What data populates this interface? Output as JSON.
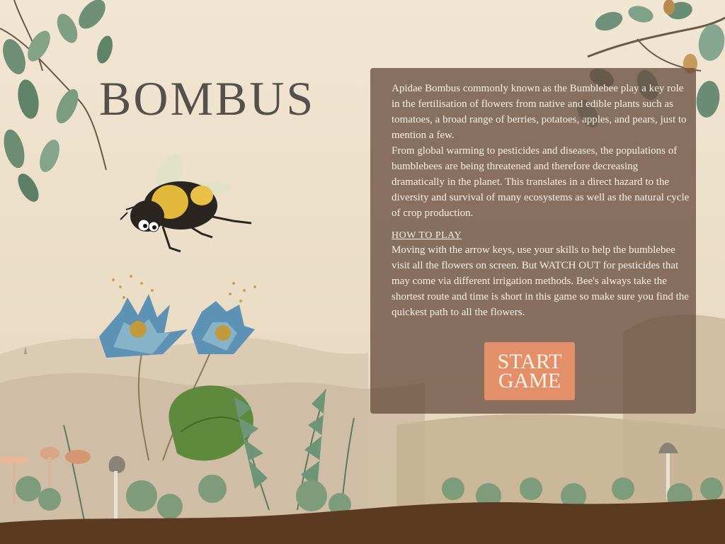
{
  "title": "BOMBUS",
  "intro": {
    "paragraphs": [
      "Apidae Bombus commonly known as the Bumblebee play a key role in the fertilisation of flowers from native and edible plants such as tomatoes, a broad range of berries, potatoes, apples, and pears, just to mention a few.",
      "From global warming to pesticides and diseases, the populations of bumblebees are being threatened and therefore decreasing dramatically in the planet. This translates in a direct hazard to the diversity and survival of many ecosystems as well as the natural cycle of crop production."
    ]
  },
  "how_to_play": {
    "heading": "HOW TO PLAY",
    "text": "Moving with the arrow keys, use your skills to help the bumblebee visit all the flowers on screen. But WATCH OUT for pesticides that may come via different irrigation methods. Bee's always take the shortest route and time is short in this game so make sure you find the quickest path to all the flowers."
  },
  "start_button": {
    "line1": "START",
    "line2": "GAME"
  },
  "colors": {
    "background": "#efe3cf",
    "panel": "#64483a",
    "button": "#e3906a",
    "title": "#56504c",
    "soil": "#5a3b22"
  },
  "icons": {
    "character": "bumblebee-icon",
    "flower": "water-lily-icon",
    "mushroom": "mushroom-icon"
  }
}
